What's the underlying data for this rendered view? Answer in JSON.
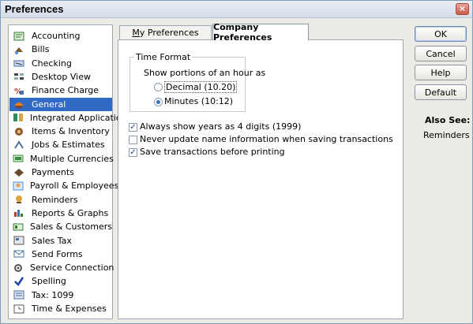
{
  "window": {
    "title": "Preferences",
    "close_label": "×"
  },
  "sidebar": {
    "items": [
      {
        "label": "Accounting",
        "icon": "accounting-icon",
        "color": "#2e7d32"
      },
      {
        "label": "Bills",
        "icon": "bills-icon",
        "color": "#7b5a2a"
      },
      {
        "label": "Checking",
        "icon": "checking-icon",
        "color": "#4a6fa5"
      },
      {
        "label": "Desktop View",
        "icon": "desktop-view-icon",
        "color": "#444444"
      },
      {
        "label": "Finance Charge",
        "icon": "finance-charge-icon",
        "color": "#c0392b"
      },
      {
        "label": "General",
        "icon": "general-icon",
        "color": "#e67e22"
      },
      {
        "label": "Integrated Applications",
        "icon": "integrated-apps-icon",
        "color": "#2e8b57"
      },
      {
        "label": "Items & Inventory",
        "icon": "items-inventory-icon",
        "color": "#8e5a2a"
      },
      {
        "label": "Jobs & Estimates",
        "icon": "jobs-estimates-icon",
        "color": "#4a6fa5"
      },
      {
        "label": "Multiple Currencies",
        "icon": "multiple-currencies-icon",
        "color": "#3a8d3a"
      },
      {
        "label": "Payments",
        "icon": "payments-icon",
        "color": "#6b4c2a"
      },
      {
        "label": "Payroll & Employees",
        "icon": "payroll-employees-icon",
        "color": "#4a90d9"
      },
      {
        "label": "Reminders",
        "icon": "reminders-icon",
        "color": "#d9a441"
      },
      {
        "label": "Reports & Graphs",
        "icon": "reports-graphs-icon",
        "color": "#c0392b"
      },
      {
        "label": "Sales & Customers",
        "icon": "sales-customers-icon",
        "color": "#2e7d32"
      },
      {
        "label": "Sales Tax",
        "icon": "sales-tax-icon",
        "color": "#555555"
      },
      {
        "label": "Send Forms",
        "icon": "send-forms-icon",
        "color": "#4a6fa5"
      },
      {
        "label": "Service Connection",
        "icon": "service-connection-icon",
        "color": "#555555"
      },
      {
        "label": "Spelling",
        "icon": "spelling-icon",
        "color": "#1d44a0"
      },
      {
        "label": "Tax: 1099",
        "icon": "tax-1099-icon",
        "color": "#4a6fa5"
      },
      {
        "label": "Time & Expenses",
        "icon": "time-expenses-icon",
        "color": "#555555"
      }
    ],
    "selected_index": 5
  },
  "tabs": {
    "my_preferences": "My Preferences",
    "company_preferences": "Company Preferences"
  },
  "time_format": {
    "group_title": "Time Format",
    "description": "Show portions of an hour as",
    "decimal_label": "Decimal (10.20)",
    "minutes_label": "Minutes (10:12)",
    "selected": "minutes"
  },
  "options": {
    "four_digit_years": {
      "label": "Always show years as 4 digits (1999)",
      "checked": true
    },
    "never_update_names": {
      "label": "Never update name information when saving transactions",
      "checked": false
    },
    "save_before_printing": {
      "label": "Save transactions before printing",
      "checked": true
    }
  },
  "buttons": {
    "ok": "OK",
    "cancel": "Cancel",
    "help": "Help",
    "default": "Default"
  },
  "also_see": {
    "title": "Also See:",
    "link": "Reminders"
  },
  "colors": {
    "selection": "#316ac5",
    "window_bg": "#ecebe5"
  }
}
